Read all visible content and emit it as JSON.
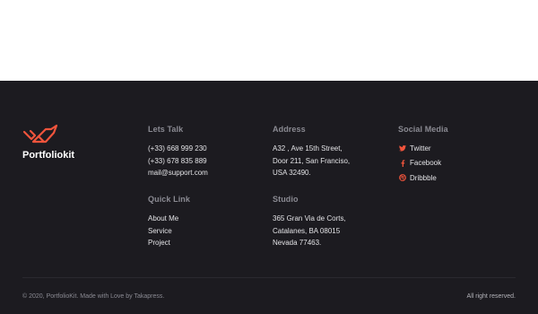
{
  "brand": {
    "name": "Portfoliokit",
    "accent": "#f0543c"
  },
  "columns": {
    "lets_talk": {
      "title": "Lets Talk",
      "lines": [
        "(+33) 668 999 230",
        "(+33) 678 835 889",
        "mail@support.com"
      ]
    },
    "address": {
      "title": "Address",
      "lines": [
        "A32 , Ave 15th Street,",
        "Door 211, San Franciso,",
        "USA 32490."
      ]
    },
    "social": {
      "title": "Social Media",
      "items": [
        {
          "label": "Twitter",
          "icon": "twitter-icon"
        },
        {
          "label": "Facebook",
          "icon": "facebook-icon"
        },
        {
          "label": "Dribbble",
          "icon": "dribbble-icon"
        }
      ]
    },
    "quick_link": {
      "title": "Quick Link",
      "links": [
        "About Me",
        "Service",
        "Project"
      ]
    },
    "studio": {
      "title": "Studio",
      "lines": [
        "365 Gran Via de Corts,",
        "Catalanes, BA 08015",
        "Nevada 77463."
      ]
    }
  },
  "bottom": {
    "copyright": "© 2020, PortfolioKit. Made with Love by Takapress.",
    "rights": "All right reserved."
  },
  "colors": {
    "footer_bg": "#1c1b20",
    "heading": "#8a8a92",
    "text": "#e3e3e6",
    "icon": "#f0543c"
  }
}
